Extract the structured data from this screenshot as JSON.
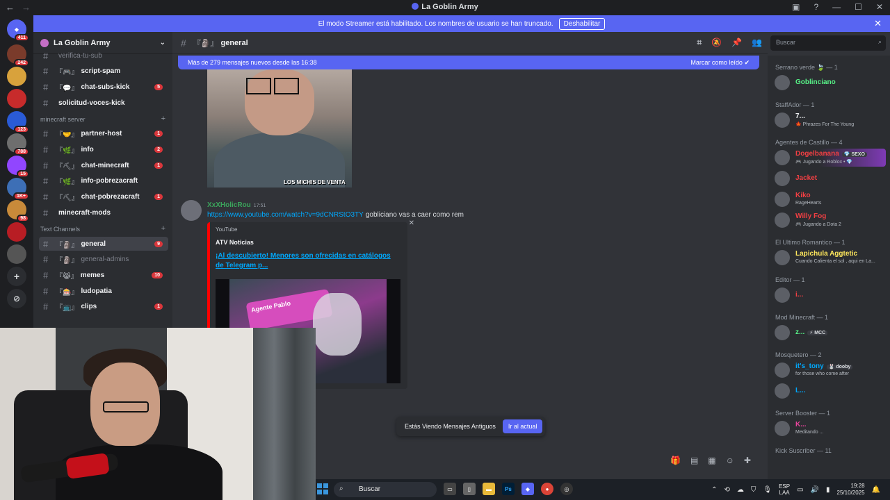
{
  "window": {
    "title": "La Goblin Army"
  },
  "banner": {
    "text": "El modo Streamer está habilitado. Los nombres de usuario se han truncado.",
    "button": "Deshabilitar"
  },
  "servers": [
    {
      "badge": "411"
    },
    {
      "badge": "242"
    },
    {
      "badge": ""
    },
    {
      "badge": ""
    },
    {
      "badge": "123"
    },
    {
      "badge": "788"
    },
    {
      "badge": "15"
    },
    {
      "badge": "1K+"
    },
    {
      "badge": "98"
    },
    {
      "badge": ""
    },
    {
      "badge": ""
    }
  ],
  "guild": {
    "name": "La Goblin Army"
  },
  "channels": {
    "top": [
      {
        "name": "verifica-tu-sub",
        "pre": "",
        "muted": true,
        "count": ""
      },
      {
        "name": "script-spam",
        "pre": "『🎮』",
        "muted": false,
        "count": ""
      },
      {
        "name": "chat-subs-kick",
        "pre": "『💬』",
        "muted": false,
        "count": "5"
      },
      {
        "name": "solicitud-voces-kick",
        "pre": "",
        "muted": false,
        "count": ""
      }
    ],
    "category_minecraft": "minecraft server",
    "minecraft": [
      {
        "name": "partner-host",
        "pre": "『🤝』",
        "muted": false,
        "count": "1"
      },
      {
        "name": "info",
        "pre": "『🌿』",
        "muted": false,
        "count": "2"
      },
      {
        "name": "chat-minecraft",
        "pre": "『⛏』",
        "muted": false,
        "count": "1"
      },
      {
        "name": "info-pobrezacraft",
        "pre": "『🌿』",
        "muted": false,
        "count": ""
      },
      {
        "name": "chat-pobrezacraft",
        "pre": "『⛏』",
        "muted": false,
        "count": "1"
      },
      {
        "name": "minecraft-mods",
        "pre": "",
        "muted": false,
        "count": ""
      }
    ],
    "category_text": "Text Channels",
    "text": [
      {
        "name": "general",
        "pre": "『🗿』",
        "muted": false,
        "count": "9",
        "active": true
      },
      {
        "name": "general-admins",
        "pre": "『🗿』",
        "muted": true,
        "count": ""
      },
      {
        "name": "memes",
        "pre": "『😹』",
        "muted": false,
        "count": "10"
      },
      {
        "name": "ludopatia",
        "pre": "『🎰』",
        "muted": false,
        "count": ""
      },
      {
        "name": "clips",
        "pre": "『📺』",
        "muted": false,
        "count": "1"
      }
    ]
  },
  "chat": {
    "channel_pre": "『🗿』",
    "channel_name": "general",
    "search_placeholder": "Buscar",
    "new_messages": "Más de 279 mensajes nuevos desde las 16:38",
    "mark_read": "Marcar como leído",
    "meme_caption": "LOS MICHIS DE VENTA",
    "message": {
      "author": "XxXHolicRou",
      "time": "17:51",
      "link": "https://www.youtube.com/watch?v=9dCNRStO3TY",
      "text": "gobliciano vas a caer como rem"
    },
    "embed": {
      "provider": "YouTube",
      "author": "ATV Noticias",
      "title": "¡Al descubierto! Menores son ofrecidas en catálogos de Telegram p...",
      "thumb_text": "Agente Pablo"
    },
    "old_messages": "Estás Viendo Mensajes Antiguos",
    "jump_button": "Ir al actual"
  },
  "members": [
    {
      "role": "Serrano verde 🍃 — 1",
      "list": [
        {
          "name": "Goblinciano",
          "status": "",
          "color": "#57f287"
        }
      ]
    },
    {
      "role": "StaffAdor — 1",
      "list": [
        {
          "name": "7...",
          "status": "🍁 Phrazes For The Young",
          "color": "#f2f3f5"
        }
      ]
    },
    {
      "role": "Agentes de Castillo — 4",
      "list": [
        {
          "name": "Dogelbanana",
          "status": "🎮 Jugando a Roblox • 💎",
          "color": "#f23f43",
          "tag": "💎 SEXO"
        },
        {
          "name": "Jacket",
          "status": "",
          "color": "#f23f43"
        },
        {
          "name": "Kiko",
          "status": "RageHearts",
          "color": "#f23f43"
        },
        {
          "name": "Willy Fog",
          "status": "🎮 Jugando a Dota 2",
          "color": "#f23f43"
        }
      ]
    },
    {
      "role": "El Ultimo Romantico — 1",
      "list": [
        {
          "name": "Lapichula Aggtetic",
          "status": "Cuando Calienta el sol , aqui en La...",
          "color": "#fee75c"
        }
      ]
    },
    {
      "role": "Editor — 1",
      "list": [
        {
          "name": "i...",
          "status": "",
          "color": "#f23f43"
        }
      ]
    },
    {
      "role": "Mod Minecraft — 1",
      "list": [
        {
          "name": "z...",
          "status": "",
          "color": "#57f287",
          "tag": "⚡ MCC"
        }
      ]
    },
    {
      "role": "Mosquetero — 2",
      "list": [
        {
          "name": "it's_tony",
          "status": "for those who come after",
          "color": "#00a8fc",
          "tag": "🐰 dooby"
        },
        {
          "name": "L...",
          "status": "",
          "color": "#00a8fc"
        }
      ]
    },
    {
      "role": "Server Booster — 1",
      "list": [
        {
          "name": "K...",
          "status": "Meditando ...",
          "color": "#eb459e"
        }
      ]
    },
    {
      "role": "Kick Suscriber — 11",
      "list": []
    }
  ],
  "taskbar": {
    "search": "Buscar",
    "lang1": "ESP",
    "lang2": "LAA",
    "time": "19:28",
    "date": "25/10/2025"
  }
}
